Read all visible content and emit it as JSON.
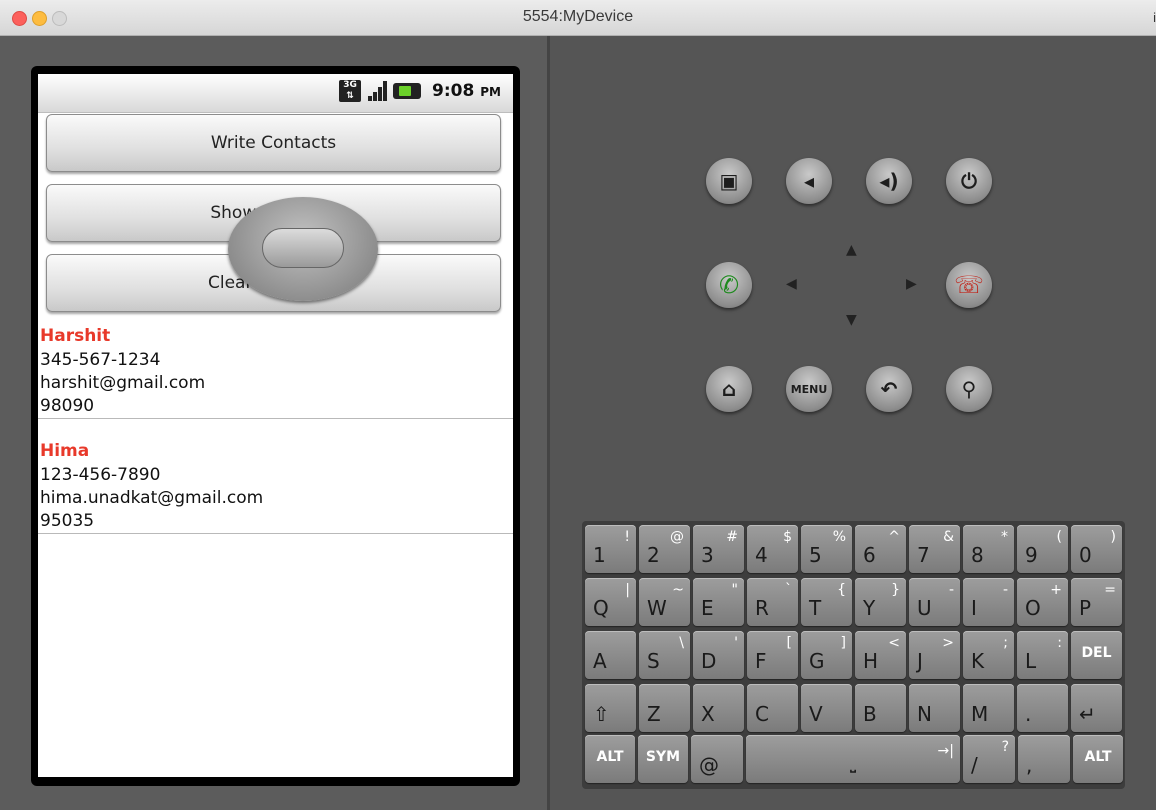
{
  "window": {
    "title": "5554:MyDevice",
    "edge_char": "i"
  },
  "status_bar": {
    "network": "3G",
    "time": "9:08",
    "ampm": "PM"
  },
  "buttons": [
    {
      "label": "Write Contacts"
    },
    {
      "label": "Show Contacts"
    },
    {
      "label": "Clear Database"
    }
  ],
  "contacts": [
    {
      "name": "Harshit",
      "phone": "345-567-1234",
      "email": "harshit@gmail.com",
      "zip": "98090"
    },
    {
      "name": "Hima",
      "phone": "123-456-7890",
      "email": "hima.unadkat@gmail.com",
      "zip": "95035"
    }
  ],
  "hardware": {
    "menu_label": "MENU"
  },
  "keyboard": {
    "rows": [
      [
        {
          "m": "1",
          "a": "!"
        },
        {
          "m": "2",
          "a": "@"
        },
        {
          "m": "3",
          "a": "#"
        },
        {
          "m": "4",
          "a": "$"
        },
        {
          "m": "5",
          "a": "%"
        },
        {
          "m": "6",
          "a": "^"
        },
        {
          "m": "7",
          "a": "&"
        },
        {
          "m": "8",
          "a": "*"
        },
        {
          "m": "9",
          "a": "("
        },
        {
          "m": "0",
          "a": ")"
        }
      ],
      [
        {
          "m": "Q",
          "a": "|"
        },
        {
          "m": "W",
          "a": "~"
        },
        {
          "m": "E",
          "a": "\""
        },
        {
          "m": "R",
          "a": "`"
        },
        {
          "m": "T",
          "a": "{"
        },
        {
          "m": "Y",
          "a": "}"
        },
        {
          "m": "U",
          "a": "-"
        },
        {
          "m": "I",
          "a": "-"
        },
        {
          "m": "O",
          "a": "+"
        },
        {
          "m": "P",
          "a": "="
        }
      ],
      [
        {
          "m": "A",
          "a": ""
        },
        {
          "m": "S",
          "a": "\\"
        },
        {
          "m": "D",
          "a": "'"
        },
        {
          "m": "F",
          "a": "["
        },
        {
          "m": "G",
          "a": "]"
        },
        {
          "m": "H",
          "a": "<"
        },
        {
          "m": "J",
          "a": ">"
        },
        {
          "m": "K",
          "a": ";"
        },
        {
          "m": "L",
          "a": ":"
        },
        {
          "m": "",
          "a": "",
          "c": "DEL"
        }
      ],
      [
        {
          "m": "⇧",
          "a": ""
        },
        {
          "m": "Z",
          "a": ""
        },
        {
          "m": "X",
          "a": ""
        },
        {
          "m": "C",
          "a": ""
        },
        {
          "m": "V",
          "a": ""
        },
        {
          "m": "B",
          "a": ""
        },
        {
          "m": "N",
          "a": ""
        },
        {
          "m": "M",
          "a": ""
        },
        {
          "m": ".",
          "a": ""
        },
        {
          "m": "↵",
          "a": ""
        }
      ]
    ],
    "bottom": {
      "alt": "ALT",
      "sym": "SYM",
      "at": "@",
      "space": "⎵",
      "tab": "→|",
      "slash": "/",
      "question": "?",
      "comma": ",",
      "alt2": "ALT"
    }
  }
}
